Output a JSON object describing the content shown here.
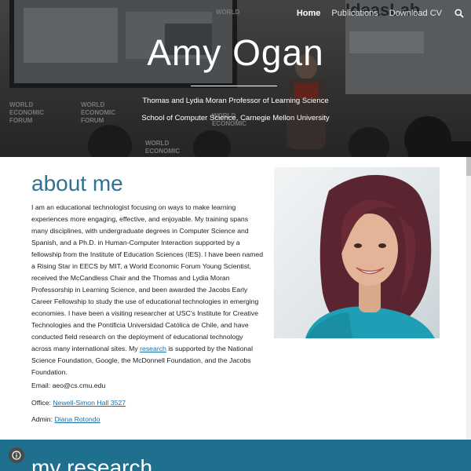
{
  "nav": {
    "items": [
      {
        "label": "Home",
        "active": true
      },
      {
        "label": "Publications",
        "active": false
      },
      {
        "label": "Download CV",
        "active": false
      }
    ]
  },
  "hero": {
    "title": "Amy Ogan",
    "subtitle_line1": "Thomas and Lydia Moran Professor of Learning Science",
    "subtitle_line2": "School of Computer Science, Carnegie Mellon University",
    "background_signage": {
      "wef_logo_lines": [
        "WORLD",
        "ECONOMIC",
        "FORUM"
      ],
      "banner_top": "IdeasLab"
    }
  },
  "about": {
    "heading": "about me",
    "bio_before_link": "I am an educational technologist focusing on ways to make learning experiences more engaging, effective, and enjoyable. My training spans many disciplines, with undergraduate degrees in Computer Science and Spanish, and a Ph.D. in Human-Computer Interaction supported by a fellowship from the Institute of Education Sciences (IES). I have been named a Rising Star in EECS by MIT, a World Economic Forum Young Scientist, received the McCandless Chair and the Thomas and Lydia Moran Professorship in Learning Science, and been awarded the Jacobs Early Career Fellowship to study the use of educational technologies in emerging economies. I have been a visiting researcher at USC's Institute for Creative Technologies and the Pontificia Universidad Católica de Chile, and have conducted field research on the deployment of educational technology across many international sites. My ",
    "bio_link": "research",
    "bio_after_link": " is supported by the National Science Foundation, Google, the McDonnell Foundation, and the Jacobs Foundation.",
    "email_label": "Email: ",
    "email_value": "aeo@cs.cmu.edu",
    "office_label": "Office: ",
    "office_link": "Newell-Simon Hall 3527",
    "admin_label": "Admin: ",
    "admin_link": "Diana Rotondo"
  },
  "research": {
    "heading": "my research"
  },
  "colors": {
    "heading_teal": "#2e7391",
    "link_blue": "#1a6ea8",
    "band_teal": "#1f6f8f"
  },
  "icons": {
    "search": "search-icon",
    "info": "info-icon"
  }
}
